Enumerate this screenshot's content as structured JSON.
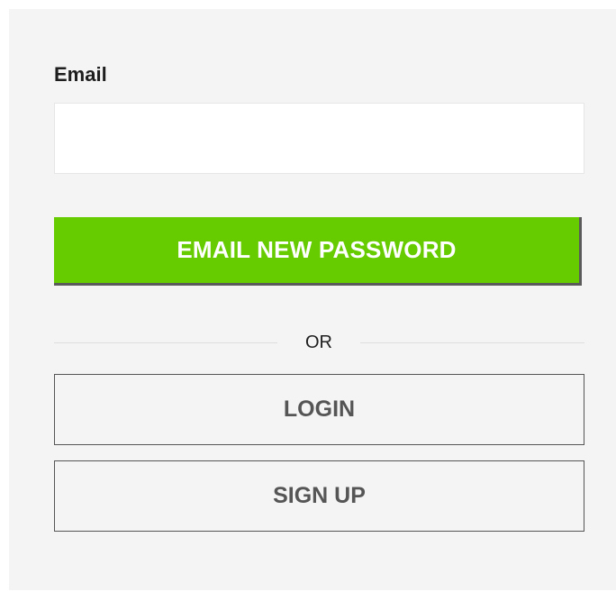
{
  "form": {
    "email_label": "Email",
    "email_value": "",
    "email_placeholder": "",
    "submit_label": "EMAIL NEW PASSWORD",
    "separator_label": "OR",
    "login_label": "LOGIN",
    "signup_label": "SIGN UP"
  },
  "colors": {
    "panel_background": "#f4f4f4",
    "primary_button": "#66cc00",
    "outline_button_text": "#555555"
  }
}
